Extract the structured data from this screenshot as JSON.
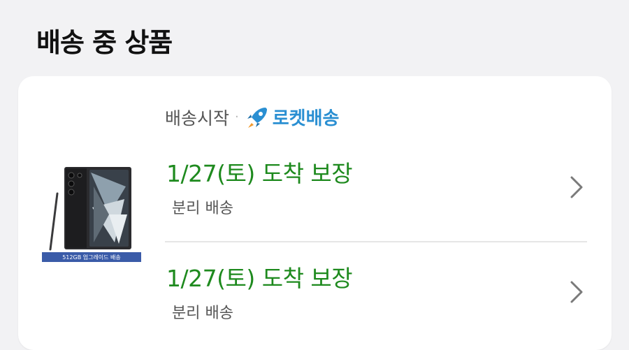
{
  "section": {
    "title": "배송 중 상품"
  },
  "product": {
    "badge_text": "512GB 업그레이드 배송"
  },
  "shipping": {
    "status": "배송시작",
    "separator": "·",
    "rocket_label": "로켓배송"
  },
  "deliveries": [
    {
      "arrival": "1/27(토) 도착 보장",
      "note": "분리 배송"
    },
    {
      "arrival": "1/27(토) 도착 보장",
      "note": "분리 배송"
    }
  ],
  "colors": {
    "arrival_green": "#1e8a1e",
    "rocket_blue": "#2a8fd2",
    "background": "#f2f2f4",
    "card": "#ffffff"
  }
}
